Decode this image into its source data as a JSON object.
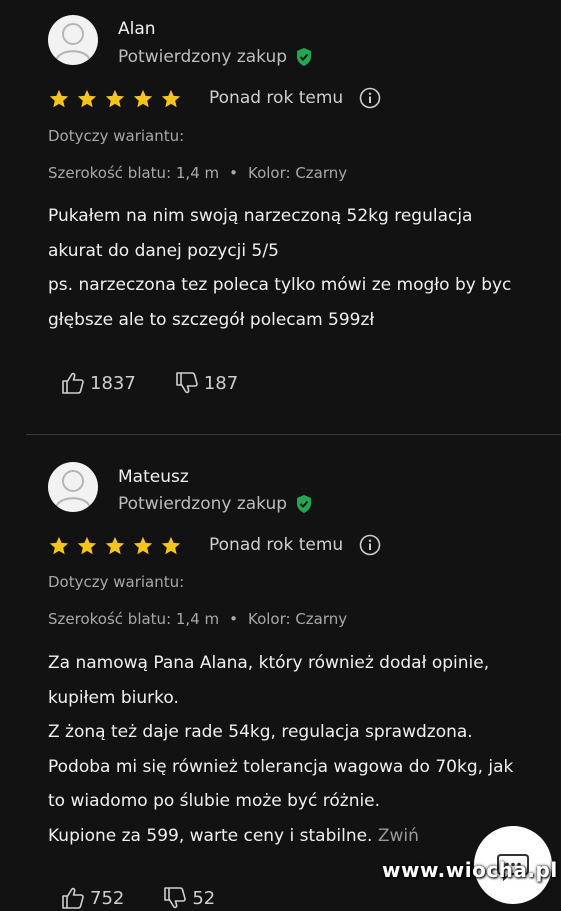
{
  "colors": {
    "background": "#121212",
    "star": "#f5c518",
    "verified": "#1fa84f",
    "text": "#f0f0f0",
    "muted": "#a8a8a8"
  },
  "reviews": [
    {
      "name": "Alan",
      "verified_label": "Potwierdzony zakup",
      "rating": 5,
      "time": "Ponad rok temu",
      "variant_label": "Dotyczy wariantu:",
      "width": "Szerokość blatu: 1,4 m",
      "color": "Kolor: Czarny",
      "lines": [
        "Pukałem na nim swoją narzeczoną 52kg regulacja",
        "akurat do danej pozycji 5/5",
        "ps. narzeczona tez poleca tylko mówi ze mogło by byc",
        "głębsze ale to szczegół polecam 599zł"
      ],
      "likes": "1837",
      "dislikes": "187"
    },
    {
      "name": "Mateusz",
      "verified_label": "Potwierdzony zakup",
      "rating": 5,
      "time": "Ponad rok temu",
      "variant_label": "Dotyczy wariantu:",
      "width": "Szerokość blatu: 1,4 m",
      "color": "Kolor: Czarny",
      "lines": [
        "Za namową Pana Alana, który również dodał opinie,",
        "kupiłem biurko.",
        "Z żoną też daje rade 54kg, regulacja sprawdzona.",
        "Podoba mi się również tolerancja wagowa do 70kg, jak",
        "to wiadomo po ślubie może być różnie.",
        "Kupione za 599, warte ceny i stabilne."
      ],
      "collapse_label": "Zwiń",
      "likes": "752",
      "dislikes": "52"
    }
  ],
  "watermark": "www.wiocha.pl"
}
